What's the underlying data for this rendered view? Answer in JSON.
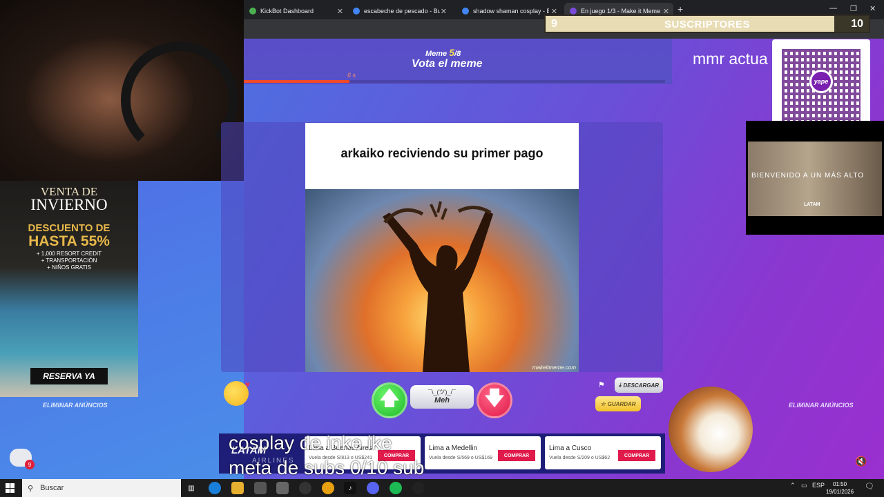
{
  "browser": {
    "tabs": [
      {
        "label": "KickBot Dashboard",
        "color": "#4caf50",
        "active": false
      },
      {
        "label": "escabeche de pescado - Buscar",
        "color": "#4285f4",
        "active": false
      },
      {
        "label": "shadow shaman cosplay - Buscar",
        "color": "#4285f4",
        "active": false
      },
      {
        "label": "En juego 1/3 - Make it Meme",
        "color": "#7a4ad8",
        "active": true
      }
    ],
    "new_tab": "+",
    "close_glyph": "✕"
  },
  "game": {
    "meme_label": "Meme",
    "meme_current": "5",
    "meme_total": "/8",
    "vote_title": "Vota el meme",
    "timer": "6 s",
    "progress": 0.25,
    "meme_caption": "arkaiko reciviendo su primer pago",
    "watermark": "makeitmeme.com",
    "meh_face": "¯\\_(ツ)_/¯",
    "meh_label": "Meh",
    "up_glyph": "🡅",
    "down_glyph": "🡇",
    "download_label": "DESCARGAR",
    "save_label": "GUARDAR",
    "remove_ads_left": "ELIMINAR ANÚNCIOS",
    "remove_ads_right": "ELIMINAR ANÚNCIOS"
  },
  "stream": {
    "mmr_text": "mmr actua",
    "subs_current": "9",
    "subs_title": "SUSCRIPTORES",
    "subs_goal": "10",
    "qr_label": "yape",
    "overlay_line1": "cosplay de inke ike",
    "overlay_line2": "meta de subs  0/10 sub",
    "chat_badge": "9"
  },
  "ad_left": {
    "line1": "VENTA DE",
    "line2": "INVIERNO",
    "line3": "DESCUENTO DE",
    "line4": "HASTA 55%",
    "line5": "+ 1,000 RESORT CREDIT",
    "line6": "+ TRANSPORTACIÓN",
    "line7": "+ NIÑOS GRATIS",
    "cta": "RESERVA YA"
  },
  "ad_right": {
    "text": "BIENVENIDO   A UN MÁS ALTO",
    "brand": "LATAM"
  },
  "banner": {
    "brand": "LATAM",
    "sub": "AIRLINES",
    "offers": [
      {
        "city": "Lima a Buenos Aires",
        "price": "Vuela desde S/813 o US$241",
        "cta": "COMPRAR"
      },
      {
        "city": "Lima a Medellin",
        "price": "Vuela desde S/569 o US$169",
        "cta": "COMPRAR"
      },
      {
        "city": "Lima a Cusco",
        "price": "Vuela desde S/209 o US$62",
        "cta": "COMPRAR"
      }
    ]
  },
  "taskbar": {
    "search_placeholder": "Buscar",
    "lang": "ESP",
    "time": "01:50",
    "date": "19/01/2026"
  }
}
